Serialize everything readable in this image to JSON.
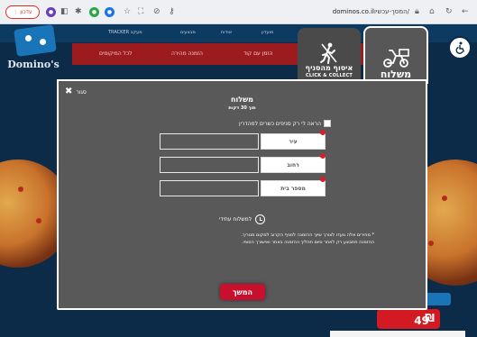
{
  "browser": {
    "update_label": "עדכון",
    "url_path": "המסך-עכשיו/",
    "url_domain": "dominos.co.il",
    "accent": "#d93025"
  },
  "site": {
    "logo_text": "Domino's",
    "nav_strip": [
      "TRACKER מעקב",
      "מבצעים",
      "אודות",
      "מועדון"
    ],
    "red_bar": [
      "לכל המיקומים",
      "הזמנה מהירה",
      "הזמן עם קוד"
    ],
    "promo_price": "49",
    "brand_red": "#c8102e",
    "brand_blue": "#1a74b8"
  },
  "tabs": {
    "delivery": {
      "label": "משלוח",
      "icon": "scooter-icon"
    },
    "carryout": {
      "label": "איסוף מהסניף",
      "sub": "CLICK & COLLECT",
      "icon": "walking-person-icon"
    }
  },
  "modal": {
    "close_label": "סגור",
    "title": "משלוח",
    "subtitle": "תוך 30 דקות",
    "only_kosher_label": "הראה לי רק סניפים כשרים למהדרין",
    "fields": [
      {
        "label": "עיר",
        "value": ""
      },
      {
        "label": "רחוב",
        "value": ""
      },
      {
        "label": "מספר בית",
        "value": ""
      }
    ],
    "future_delivery_label": "למשלוח עתידי",
    "note_line1": "* מחירים אלה נועדו לצורך שיוך ההזמנה לסניף הקרוב למקום מגוריך.",
    "note_line2": "ההזמנה תתבצע רק לאחר סיום תהליך ההזמנה באתר ואישורך הסופי.",
    "continue_label": "המשך"
  }
}
